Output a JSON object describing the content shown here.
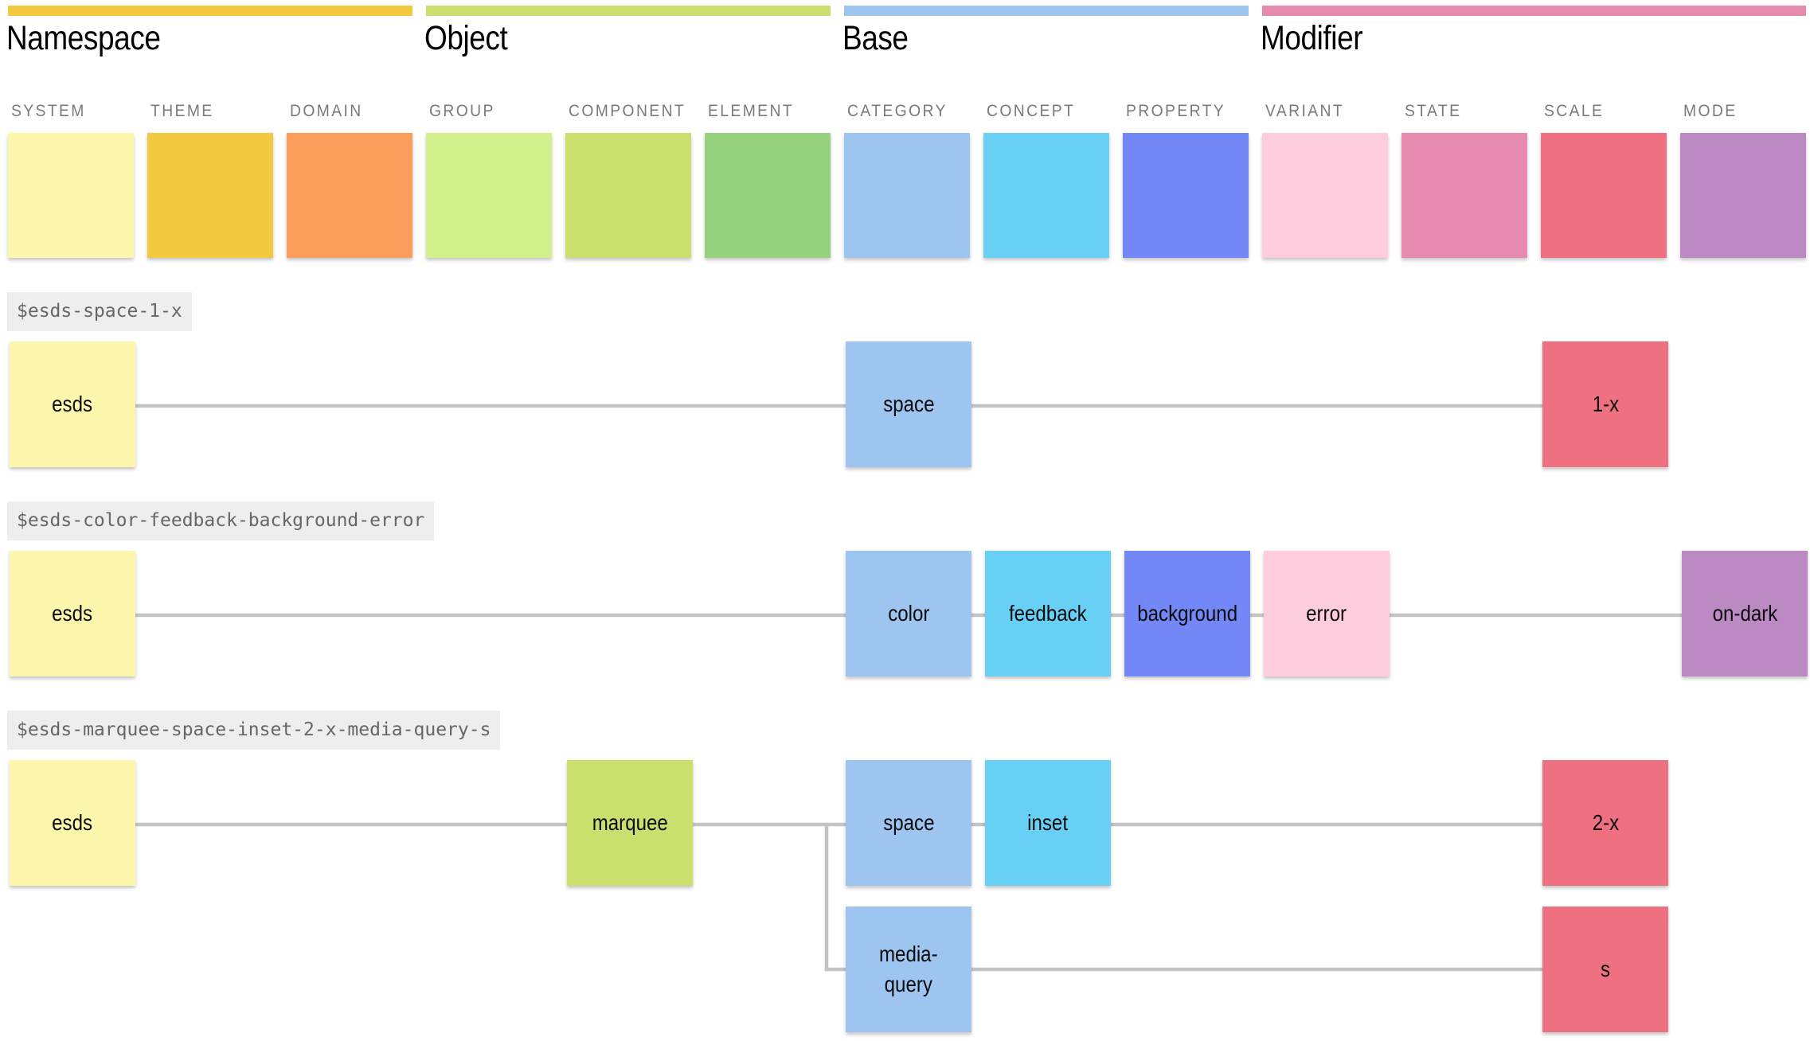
{
  "groups": [
    {
      "title": "Namespace",
      "color": "#f2c940",
      "columns": [
        {
          "label": "SYSTEM",
          "color": "#fdf7ad"
        },
        {
          "label": "THEME",
          "color": "#f2c940"
        },
        {
          "label": "DOMAIN",
          "color": "#fb9e5b"
        }
      ]
    },
    {
      "title": "Object",
      "color": "#cbdf6e",
      "columns": [
        {
          "label": "GROUP",
          "color": "#d2f08b"
        },
        {
          "label": "COMPONENT",
          "color": "#cbdf6e"
        },
        {
          "label": "ELEMENT",
          "color": "#96d27f"
        }
      ]
    },
    {
      "title": "Base",
      "color": "#9dc5f0",
      "columns": [
        {
          "label": "CATEGORY",
          "color": "#9dc5f0"
        },
        {
          "label": "CONCEPT",
          "color": "#67d0f4"
        },
        {
          "label": "PROPERTY",
          "color": "#7387f7"
        }
      ]
    },
    {
      "title": "Modifier",
      "color": "#e68ab0",
      "columns": [
        {
          "label": "VARIANT",
          "color": "#fdcddd"
        },
        {
          "label": "STATE",
          "color": "#e68ab0"
        },
        {
          "label": "SCALE",
          "color": "#ee7081"
        },
        {
          "label": "MODE",
          "color": "#bb8ac3"
        }
      ]
    }
  ],
  "connector_color": "#c4c4c4",
  "label_background": "#efeeef",
  "tokens": [
    {
      "name": "$esds-space-1-x",
      "nodes": [
        {
          "text": "esds",
          "column": "SYSTEM",
          "branch": 0
        },
        {
          "text": "space",
          "column": "CATEGORY",
          "branch": 0
        },
        {
          "text": "1-x",
          "column": "SCALE",
          "branch": 0
        }
      ]
    },
    {
      "name": "$esds-color-feedback-background-error",
      "nodes": [
        {
          "text": "esds",
          "column": "SYSTEM",
          "branch": 0
        },
        {
          "text": "color",
          "column": "CATEGORY",
          "branch": 0
        },
        {
          "text": "feedback",
          "column": "CONCEPT",
          "branch": 0
        },
        {
          "text": "background",
          "column": "PROPERTY",
          "branch": 0
        },
        {
          "text": "error",
          "column": "VARIANT",
          "branch": 0
        },
        {
          "text": "on-dark",
          "column": "MODE",
          "branch": 0
        }
      ]
    },
    {
      "name": "$esds-marquee-space-inset-2-x-media-query-s",
      "nodes": [
        {
          "text": "esds",
          "column": "SYSTEM",
          "branch": 0
        },
        {
          "text": "marquee",
          "column": "COMPONENT",
          "branch": 0
        },
        {
          "text": "space",
          "column": "CATEGORY",
          "branch": 0
        },
        {
          "text": "inset",
          "column": "CONCEPT",
          "branch": 0
        },
        {
          "text": "2-x",
          "column": "SCALE",
          "branch": 0
        },
        {
          "text": "media-\nquery",
          "column": "CATEGORY",
          "branch": 1
        },
        {
          "text": "s",
          "column": "SCALE",
          "branch": 1
        }
      ],
      "branch_from": "marquee"
    }
  ]
}
